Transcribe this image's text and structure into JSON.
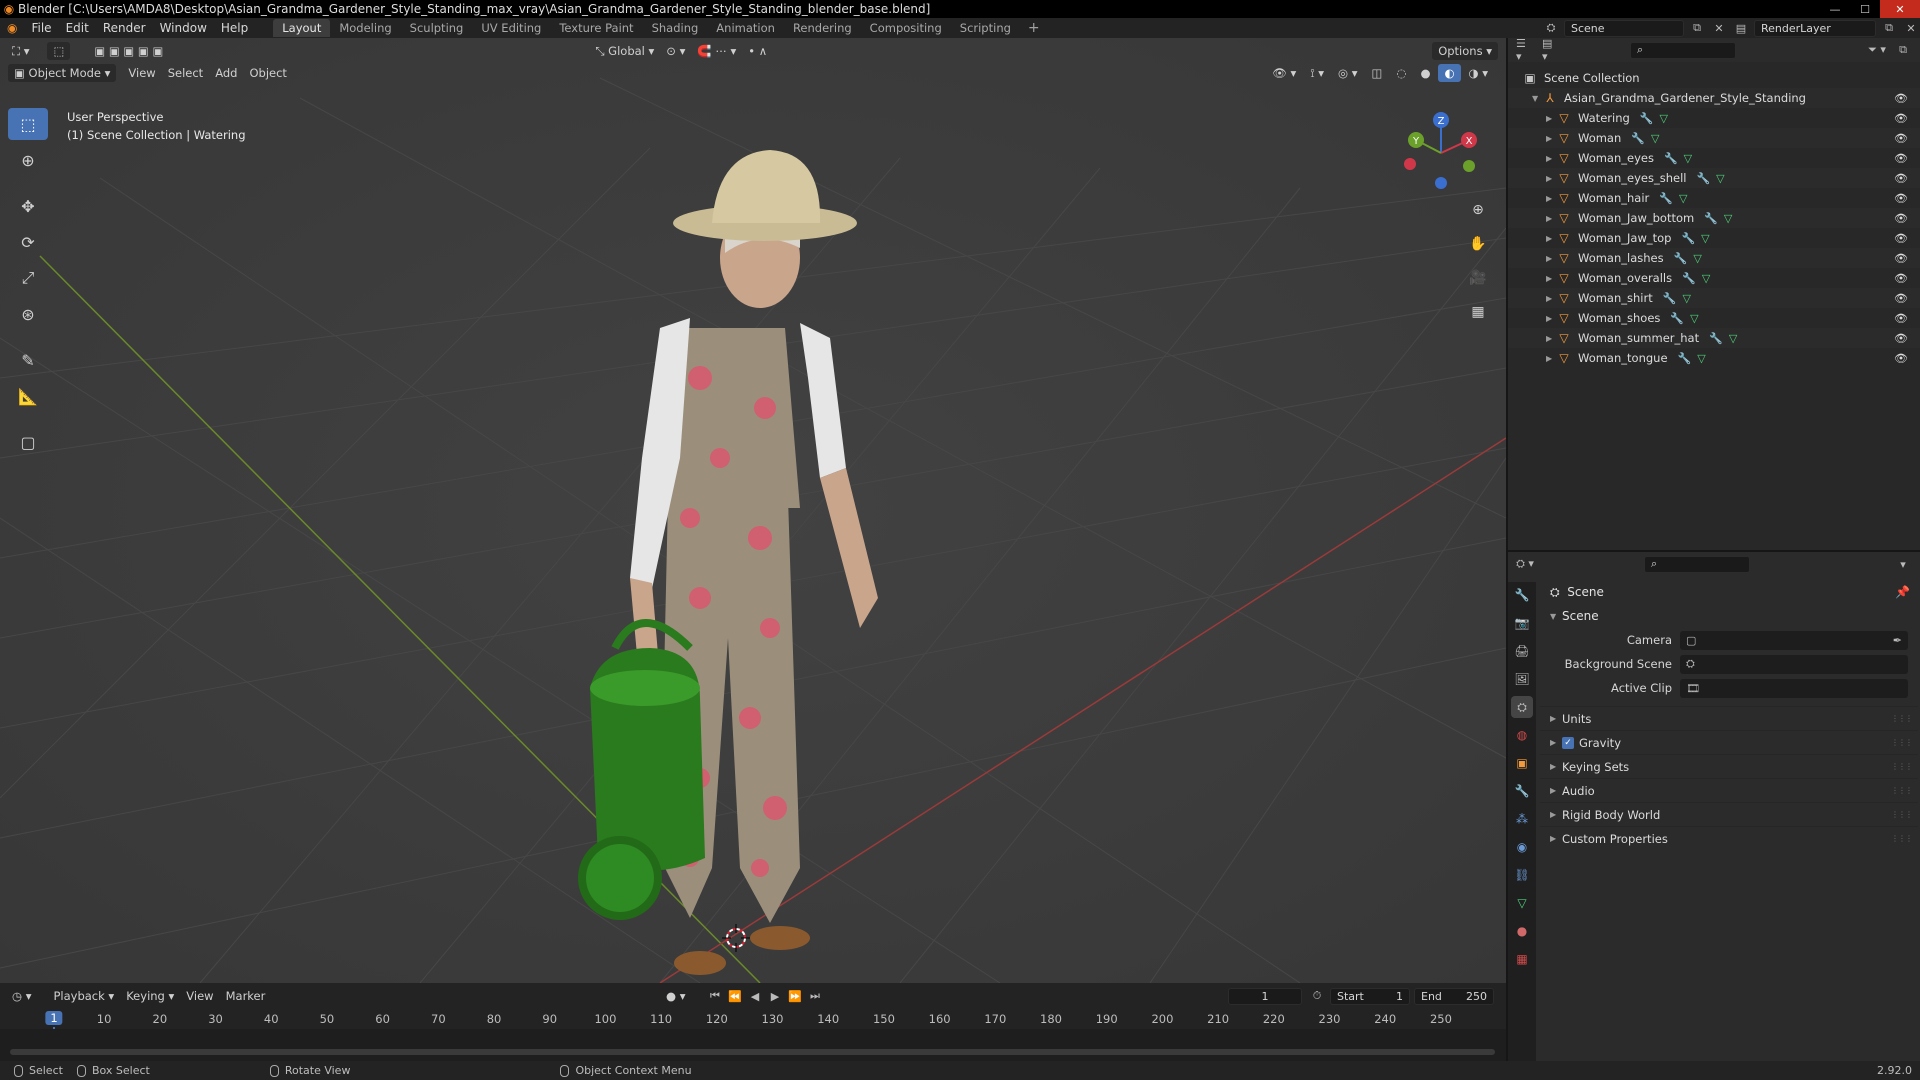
{
  "window": {
    "title": "Blender [C:\\Users\\AMDA8\\Desktop\\Asian_Grandma_Gardener_Style_Standing_max_vray\\Asian_Grandma_Gardener_Style_Standing_blender_base.blend]"
  },
  "topbar": {
    "menus": [
      "File",
      "Edit",
      "Render",
      "Window",
      "Help"
    ],
    "workspaces": [
      "Layout",
      "Modeling",
      "Sculpting",
      "UV Editing",
      "Texture Paint",
      "Shading",
      "Animation",
      "Rendering",
      "Compositing",
      "Scripting"
    ],
    "active_workspace": "Layout",
    "add_workspace": "+",
    "scene_field": "Scene",
    "view_layer_field": "RenderLayer"
  },
  "viewport": {
    "mode": "Object Mode",
    "menus": [
      "View",
      "Select",
      "Add",
      "Object"
    ],
    "transform_orientation": "Global",
    "options_label": "Options",
    "info_line1": "User Perspective",
    "info_line2": "(1) Scene Collection | Watering",
    "gizmo_axes": {
      "x": "X",
      "y": "Y",
      "z": "Z"
    },
    "colors": {
      "grid_x": "#9b3a3a",
      "grid_y": "#6a8a2a",
      "background": "#3d3d3d"
    }
  },
  "toolbar": {
    "tools": [
      "select-box",
      "cursor",
      "move",
      "rotate",
      "scale",
      "transform",
      "annotate",
      "measure",
      "add-cube"
    ]
  },
  "outliner": {
    "root": "Scene Collection",
    "collection": "Asian_Grandma_Gardener_Style_Standing",
    "objects": [
      "Watering",
      "Woman",
      "Woman_eyes",
      "Woman_eyes_shell",
      "Woman_hair",
      "Woman_Jaw_bottom",
      "Woman_Jaw_top",
      "Woman_lashes",
      "Woman_overalls",
      "Woman_shirt",
      "Woman_shoes",
      "Woman_summer_hat",
      "Woman_tongue"
    ]
  },
  "properties": {
    "breadcrumb": "Scene",
    "panel_title": "Scene",
    "fields": [
      {
        "label": "Camera",
        "value": ""
      },
      {
        "label": "Background Scene",
        "value": ""
      },
      {
        "label": "Active Clip",
        "value": ""
      }
    ],
    "subpanels": [
      "Units",
      "Gravity",
      "Keying Sets",
      "Audio",
      "Rigid Body World",
      "Custom Properties"
    ],
    "gravity_checked": true
  },
  "timeline": {
    "menus": [
      "Playback",
      "Keying",
      "View",
      "Marker"
    ],
    "current_frame": "1",
    "start_label": "Start",
    "start_value": "1",
    "end_label": "End",
    "end_value": "250",
    "ruler": [
      "10",
      "20",
      "30",
      "40",
      "50",
      "60",
      "70",
      "80",
      "90",
      "100",
      "110",
      "120",
      "130",
      "140",
      "150",
      "160",
      "170",
      "180",
      "190",
      "200",
      "210",
      "220",
      "230",
      "240",
      "250"
    ],
    "ruler_current": "1"
  },
  "statusbar": {
    "select": "Select",
    "box_select": "Box Select",
    "rotate_view": "Rotate View",
    "context_menu": "Object Context Menu",
    "version": "2.92.0"
  }
}
